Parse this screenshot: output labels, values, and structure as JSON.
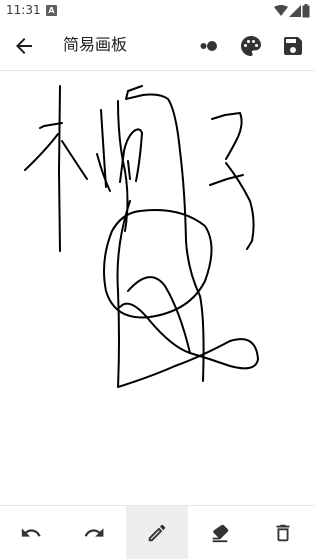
{
  "status": {
    "time": "11:31",
    "notification_badge": "A"
  },
  "app_bar": {
    "title": "简易画板"
  },
  "toolbar": {
    "active_tool": "pen",
    "tools": [
      {
        "name": "undo",
        "icon": "undo-icon"
      },
      {
        "name": "redo",
        "icon": "redo-icon"
      },
      {
        "name": "pen",
        "icon": "pencil-icon"
      },
      {
        "name": "eraser",
        "icon": "eraser-icon"
      },
      {
        "name": "clear",
        "icon": "trash-icon"
      }
    ]
  },
  "colors": {
    "stroke": "#000000",
    "active_tool_bg": "#eeeeee",
    "icon": "#333333"
  }
}
